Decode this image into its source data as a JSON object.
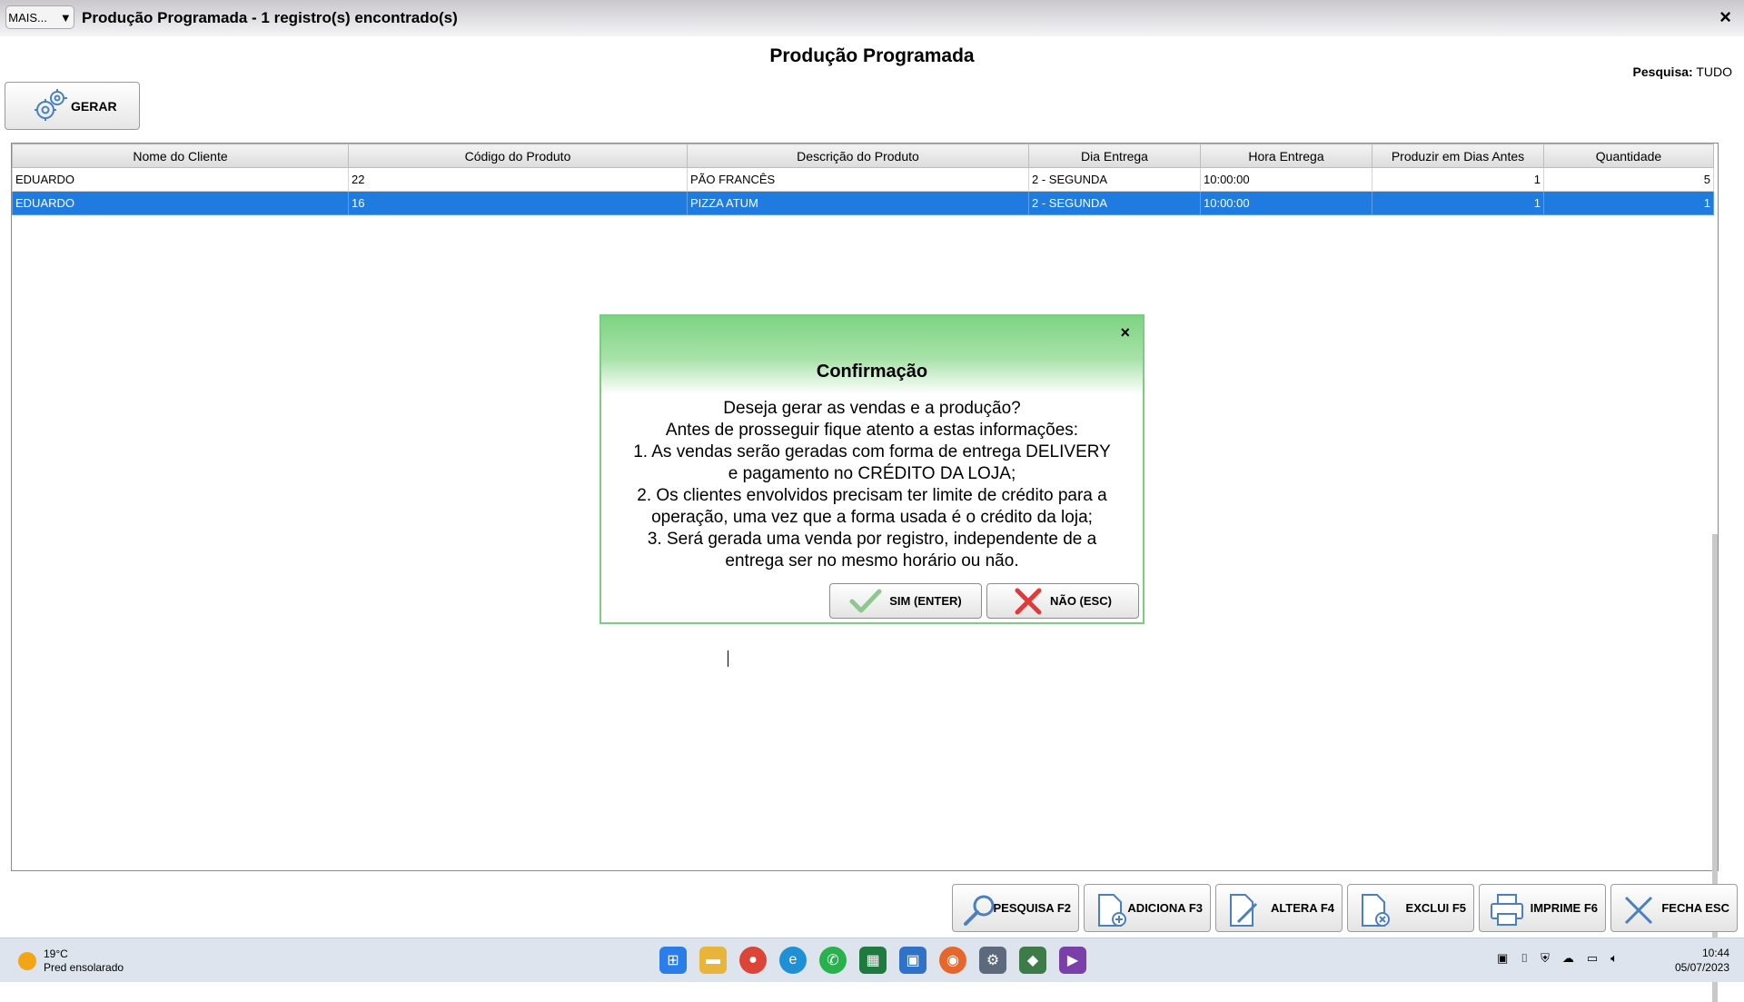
{
  "window": {
    "mais_label": "MAIS...",
    "mais_arrow": "▼",
    "title": "Produção Programada - 1 registro(s) encontrado(s)",
    "close": "×"
  },
  "header": {
    "page_title": "Produção Programada",
    "pesquisa_label": "Pesquisa:",
    "pesquisa_value": "TUDO",
    "gerar_label": "GERAR"
  },
  "grid": {
    "columns": [
      "Nome do Cliente",
      "Código do Produto",
      "Descrição do Produto",
      "Dia Entrega",
      "Hora Entrega",
      "Produzir em Dias Antes",
      "Quantidade"
    ],
    "rows": [
      {
        "cliente": "EDUARDO",
        "codigo": "22",
        "descricao": "PÃO FRANCÊS",
        "dia": "2 - SEGUNDA",
        "hora": "10:00:00",
        "dias_antes": "1",
        "quantidade": "5",
        "selected": false
      },
      {
        "cliente": "EDUARDO",
        "codigo": "16",
        "descricao": "PIZZA ATUM",
        "dia": "2 - SEGUNDA",
        "hora": "10:00:00",
        "dias_antes": "1",
        "quantidade": "1",
        "selected": true
      }
    ]
  },
  "dialog": {
    "title": "Confirmação",
    "close": "×",
    "lines": [
      "Deseja gerar as vendas e a produção?",
      "Antes de prosseguir fique atento a estas informações:",
      "1. As vendas serão geradas com forma de entrega DELIVERY",
      "e pagamento no CRÉDITO DA LOJA;",
      "2. Os clientes envolvidos precisam ter limite de crédito para a",
      "operação, uma vez que a forma usada é o crédito da loja;",
      "3. Será gerada uma venda por registro, independente de a",
      "entrega ser no mesmo horário ou não."
    ],
    "yes_label": "SIM (ENTER)",
    "no_label": "NÃO (ESC)"
  },
  "toolbar": {
    "pesquisa": "PESQUISA F2",
    "adiciona": "ADICIONA F3",
    "altera": "ALTERA F4",
    "exclui": "EXCLUI F5",
    "imprime": "IMPRIME F6",
    "fecha": "FECHA ESC"
  },
  "taskbar": {
    "temperature": "19°C",
    "weather": "Pred ensolarado",
    "time": "10:44",
    "date": "05/07/2023"
  },
  "colors": {
    "selection": "#1f7bdf",
    "dialog_green": "#7ed483"
  }
}
